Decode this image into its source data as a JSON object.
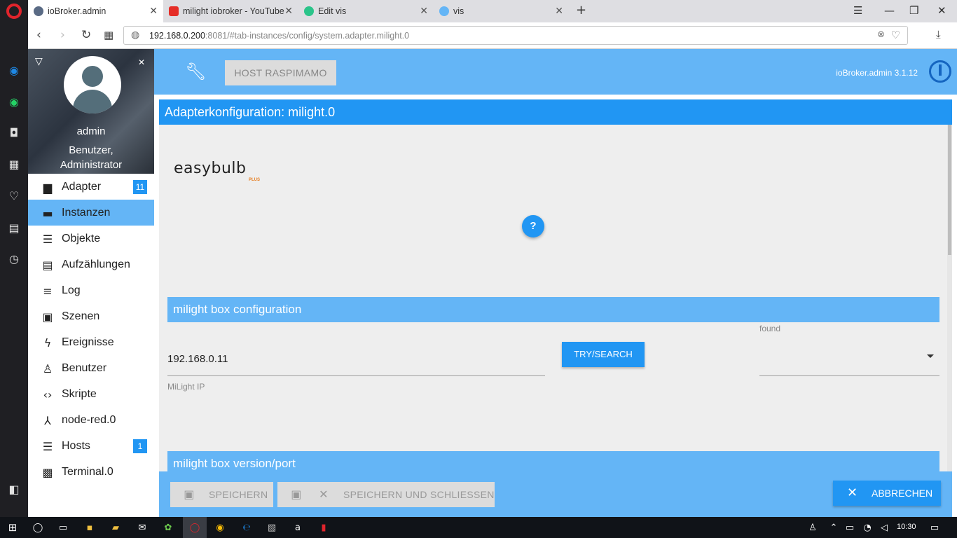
{
  "browser": {
    "tabs": [
      {
        "title": "ioBroker.admin",
        "icon": "iobroker-icon",
        "color": "#5a6b85"
      },
      {
        "title": "milight iobroker - YouTube",
        "icon": "youtube-icon",
        "color": "#e52d27"
      },
      {
        "title": "Edit vis",
        "icon": "vis-icon",
        "color": "#2bc48a"
      },
      {
        "title": "vis",
        "icon": "vis-icon",
        "color": "#64b5f6"
      }
    ],
    "new_tab_label": "+",
    "url_host": "192.168.0.200",
    "url_rest": ":8081/#tab-instances/config/system.adapter.milight.0"
  },
  "sidebar": {
    "user_name": "admin",
    "user_roles": "Benutzer,",
    "user_roles2": "Administrator",
    "items": [
      {
        "label": "Adapter",
        "icon": "store-icon",
        "badge": "11"
      },
      {
        "label": "Instanzen",
        "icon": "instances-icon",
        "active": true
      },
      {
        "label": "Objekte",
        "icon": "list-icon"
      },
      {
        "label": "Aufzählungen",
        "icon": "enums-icon"
      },
      {
        "label": "Log",
        "icon": "log-icon"
      },
      {
        "label": "Szenen",
        "icon": "scenes-icon"
      },
      {
        "label": "Ereignisse",
        "icon": "flash-icon"
      },
      {
        "label": "Benutzer",
        "icon": "user-icon"
      },
      {
        "label": "Skripte",
        "icon": "code-icon"
      },
      {
        "label": "node-red.0",
        "icon": "node-red-icon"
      },
      {
        "label": "Hosts",
        "icon": "hosts-icon",
        "badge": "1"
      },
      {
        "label": "Terminal.0",
        "icon": "terminal-icon"
      }
    ]
  },
  "header": {
    "host_button": "HOST RASPIMAMO",
    "version": "ioBroker.admin 3.1.12"
  },
  "config": {
    "title": "Adapterkonfiguration: milight.0",
    "logo_text": "easybulb",
    "logo_sub": "PLUS",
    "help_icon": "?",
    "section1_title": "milight box configuration",
    "found_label": "found",
    "ip_value": "192.168.0.11",
    "ip_label": "MiLight IP",
    "try_button": "TRY/SEARCH",
    "section2_title": "milight box version/port"
  },
  "actions": {
    "save": "SPEICHERN",
    "save_close": "SPEICHERN UND SCHLIESSEN",
    "cancel": "ABBRECHEN"
  },
  "taskbar": {
    "time": "10:30"
  },
  "colors": {
    "primary": "#2196f3",
    "header": "#64b5f6",
    "content_bg": "#eeeeee"
  }
}
